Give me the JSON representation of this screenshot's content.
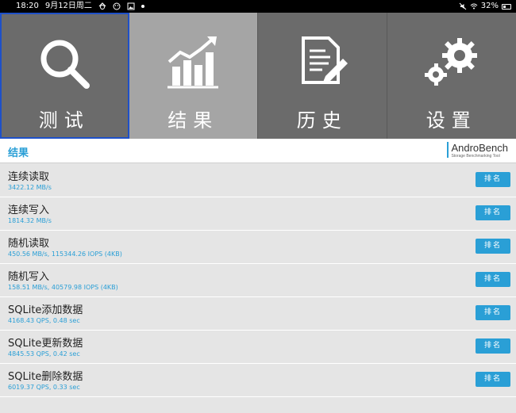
{
  "status_bar": {
    "time": "18:20",
    "date": "9月12日周二",
    "battery": "32%"
  },
  "tabs": [
    {
      "label": "测试",
      "icon": "search-icon"
    },
    {
      "label": "结果",
      "icon": "chart-icon"
    },
    {
      "label": "历史",
      "icon": "document-icon"
    },
    {
      "label": "设置",
      "icon": "gear-icon"
    }
  ],
  "section": {
    "title": "结果",
    "brand_name": "AndroBench",
    "brand_tagline": "Storage Benchmarking Tool"
  },
  "results": [
    {
      "title": "连续读取",
      "value": "3422.12 MB/s",
      "button": "排名"
    },
    {
      "title": "连续写入",
      "value": "1814.32 MB/s",
      "button": "排名"
    },
    {
      "title": "随机读取",
      "value": "450.56 MB/s, 115344.26 IOPS (4KB)",
      "button": "排名"
    },
    {
      "title": "随机写入",
      "value": "158.51 MB/s, 40579.98 IOPS (4KB)",
      "button": "排名"
    },
    {
      "title": "SQLite添加数据",
      "value": "4168.43 QPS, 0.48 sec",
      "button": "排名"
    },
    {
      "title": "SQLite更新数据",
      "value": "4845.53 QPS, 0.42 sec",
      "button": "排名"
    },
    {
      "title": "SQLite删除数据",
      "value": "6019.37 QPS, 0.33 sec",
      "button": "排名"
    }
  ],
  "colors": {
    "accent": "#2a9fd6",
    "tab_bg": "#6b6b6b",
    "tab_active_bg": "#a5a5a5",
    "selection_border": "#1e50c8"
  }
}
